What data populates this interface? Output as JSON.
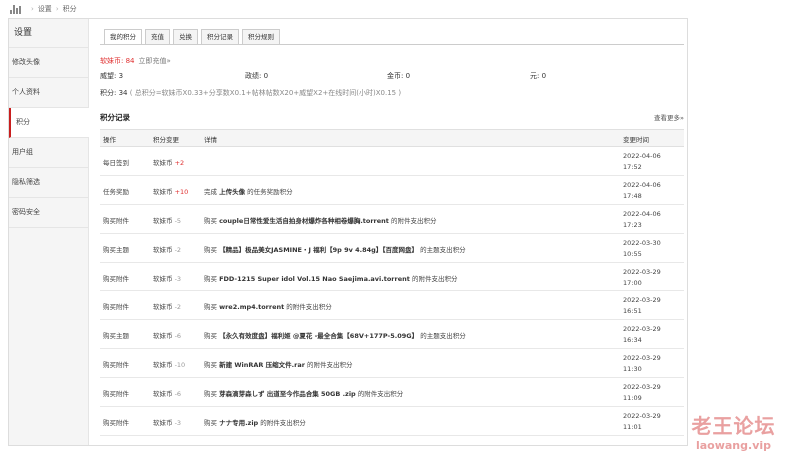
{
  "breadcrumb": {
    "first": "设置",
    "second": "积分"
  },
  "sidebar": {
    "title": "设置",
    "items": [
      {
        "label": "修改头像"
      },
      {
        "label": "个人资料"
      },
      {
        "label": "积分"
      },
      {
        "label": "用户组"
      },
      {
        "label": "隐私筛选"
      },
      {
        "label": "密码安全"
      }
    ]
  },
  "tabs": [
    {
      "label": "我的积分"
    },
    {
      "label": "充值"
    },
    {
      "label": "兑换"
    },
    {
      "label": "积分记录"
    },
    {
      "label": "积分规则"
    }
  ],
  "balance": {
    "label": "软妹币: 84",
    "recharge": "立即充值»"
  },
  "stats": {
    "weiwang": "威望: 3",
    "gongxian": "政绩: 0",
    "jinbi": "金币: 0",
    "yuan": "元: 0"
  },
  "formula": {
    "label": "积分: 34",
    "text": "( 总积分=软妹币X0.33+分享数X0.1+帖林帖数X20+威望X2+在线时间(小时)X0.15 )"
  },
  "records": {
    "title": "积分记录",
    "more": "查看更多»",
    "headers": [
      "操作",
      "积分变更",
      "详情",
      "变更时间"
    ],
    "rows": [
      {
        "op": "每日签到",
        "currency": "软妹币",
        "delta": "+2",
        "pre": "",
        "bold": "",
        "post": "",
        "date": "2022-04-06",
        "time": "17:52"
      },
      {
        "op": "任务奖励",
        "currency": "软妹币",
        "delta": "+10",
        "pre": "完成 ",
        "bold": "上传头像",
        "post": " 的任务奖励积分",
        "date": "2022-04-06",
        "time": "17:48"
      },
      {
        "op": "购买附件",
        "currency": "软妹币",
        "delta": "-5",
        "pre": "购买 ",
        "bold": "couple日常性爱生活自拍身材爆炸各种相卷爆胸.torrent",
        "post": " 的附件支出积分",
        "date": "2022-04-06",
        "time": "17:23"
      },
      {
        "op": "购买主题",
        "currency": "软妹币",
        "delta": "-2",
        "pre": "购买 ",
        "bold": "【精品】极品美女JASMINE・J 福利【9p 9v 4.84g】【百度网盘】",
        "post": " 的主题支出积分",
        "date": "2022-03-30",
        "time": "10:55"
      },
      {
        "op": "购买附件",
        "currency": "软妹币",
        "delta": "-3",
        "pre": "购买 ",
        "bold": "FDD-1215 Super idol Vol.15 Nao Saejima.avi.torrent",
        "post": " 的附件支出积分",
        "date": "2022-03-29",
        "time": "17:00"
      },
      {
        "op": "购买附件",
        "currency": "软妹币",
        "delta": "-2",
        "pre": "购买 ",
        "bold": "wre2.mp4.torrent",
        "post": " 的附件支出积分",
        "date": "2022-03-29",
        "time": "16:51"
      },
      {
        "op": "购买主题",
        "currency": "软妹币",
        "delta": "-6",
        "pre": "购买 ",
        "bold": "【永久有效度盘】福利姬 @夏花 -最全合集【68V+177P-5.09G】",
        "post": " 的主题支出积分",
        "date": "2022-03-29",
        "time": "16:34"
      },
      {
        "op": "购买附件",
        "currency": "软妹币",
        "delta": "-10",
        "pre": "购买 ",
        "bold": "新建 WinRAR 压缩文件.rar",
        "post": " 的附件支出积分",
        "date": "2022-03-29",
        "time": "11:30"
      },
      {
        "op": "购买附件",
        "currency": "软妹币",
        "delta": "-6",
        "pre": "购买 ",
        "bold": "芽森滴芽森しず 出道至今作品合集 50GB .zip",
        "post": " 的附件支出积分",
        "date": "2022-03-29",
        "time": "11:09"
      },
      {
        "op": "购买附件",
        "currency": "软妹币",
        "delta": "-3",
        "pre": "购买 ",
        "bold": "ナナ专用.zip",
        "post": " 的附件支出积分",
        "date": "2022-03-29",
        "time": "11:01"
      }
    ]
  },
  "watermark": {
    "cn": "老王论坛",
    "en": "laowang.vip"
  }
}
